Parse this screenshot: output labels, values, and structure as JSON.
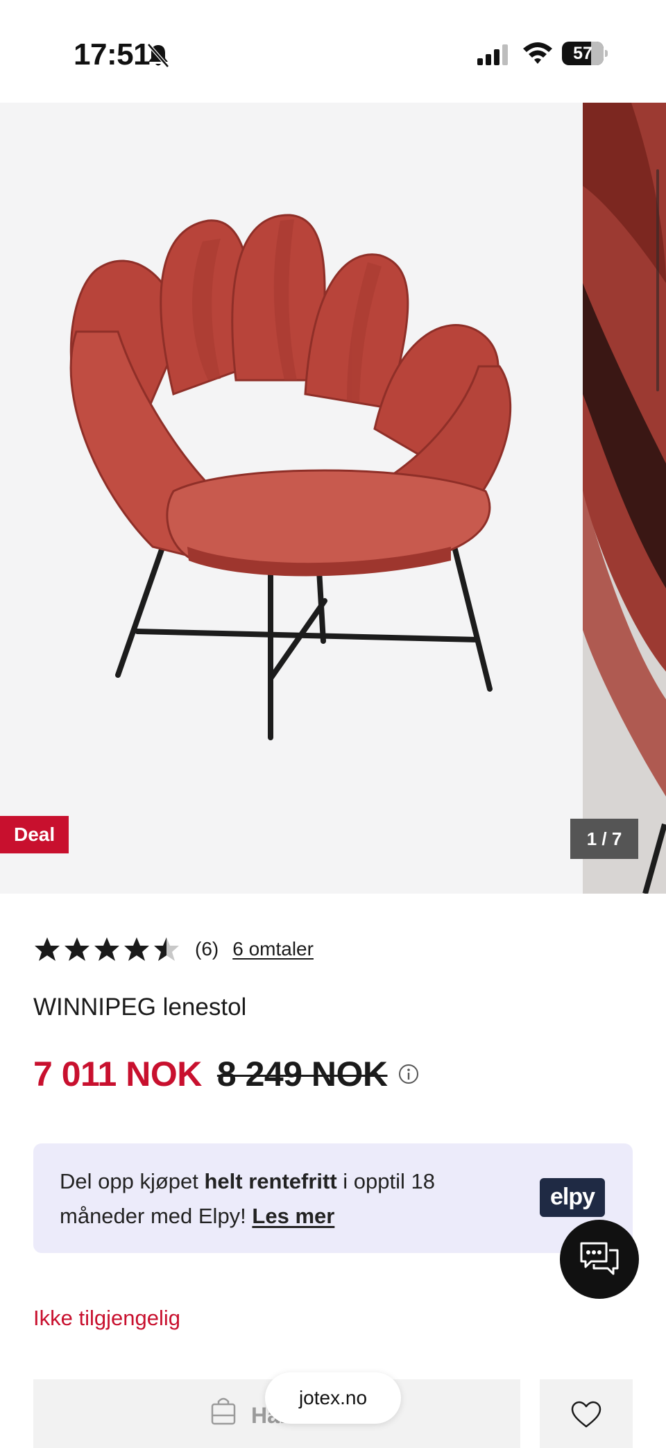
{
  "status_bar": {
    "time": "17:51",
    "battery": "57"
  },
  "gallery": {
    "deal_badge": "Deal",
    "counter": "1 / 7"
  },
  "product": {
    "rating_value": 4.5,
    "rating_max": 5,
    "rating_count": "(6)",
    "reviews_link": "6 omtaler",
    "title": "WINNIPEG lenestol",
    "price_current": "7 011 NOK",
    "price_old": "8 249 NOK"
  },
  "elpy": {
    "text_before": "Del opp kjøpet ",
    "text_bold": "helt rentefritt",
    "text_after": " i opptil 18 måneder med Elpy! ",
    "link": "Les mer",
    "logo": "elpy"
  },
  "availability": "Ikke tilgjengelig",
  "actions": {
    "buy_label": "Handle",
    "buy_icon": "shopping-bag-icon",
    "wishlist_icon": "heart-icon",
    "chat_icon": "chat-bubbles-icon"
  },
  "browser": {
    "url": "jotex.no"
  },
  "colors": {
    "brand_red": "#c8102e",
    "banner_bg": "#ecebfa",
    "elpy_navy": "#1f2a44",
    "chair_red": "#b8443a"
  }
}
